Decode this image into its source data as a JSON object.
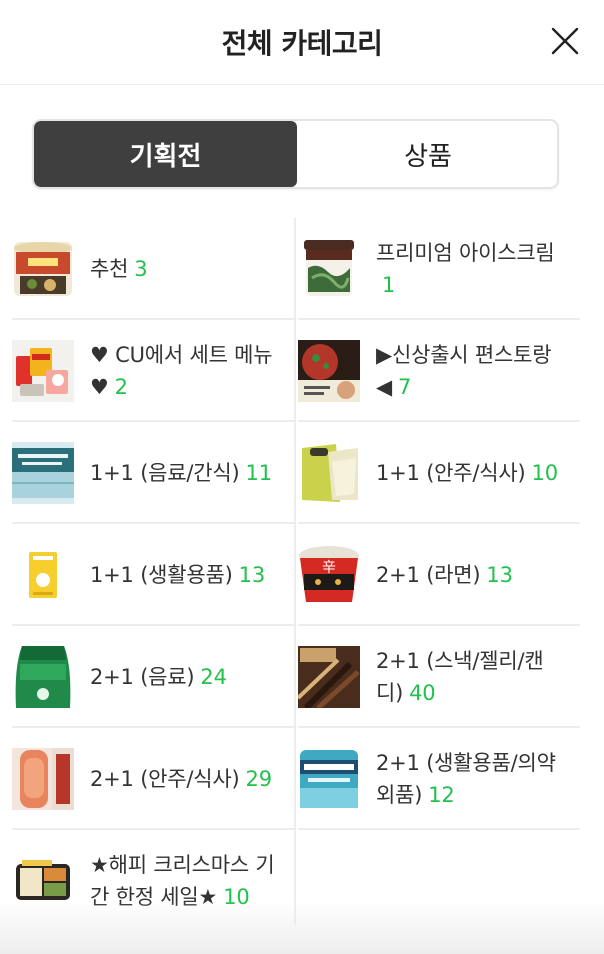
{
  "header": {
    "title": "전체 카테고리",
    "close_icon": "close-icon"
  },
  "tabs": [
    {
      "label": "기획전",
      "active": true
    },
    {
      "label": "상품",
      "active": false
    }
  ],
  "categories": [
    {
      "label": "추천",
      "count": "3",
      "icon": "ramen-cup-icon"
    },
    {
      "label": "프리미엄 아이스크림",
      "count": "1",
      "icon": "ice-cream-tub-icon"
    },
    {
      "label": "♥ CU에서 세트 메뉴 ♥",
      "count": "2",
      "icon": "set-menu-icon"
    },
    {
      "label": "▶신상출시 편스토랑◀",
      "count": "7",
      "icon": "new-product-icon"
    },
    {
      "label": "1+1 (음료/간식)",
      "count": "11",
      "icon": "water-bottle-icon"
    },
    {
      "label": "1+1 (안주/식사)",
      "count": "10",
      "icon": "snack-bag-icon"
    },
    {
      "label": "1+1 (생활용품)",
      "count": "13",
      "icon": "mask-pack-icon"
    },
    {
      "label": "2+1 (라면)",
      "count": "13",
      "icon": "noodle-bowl-icon"
    },
    {
      "label": "2+1 (음료)",
      "count": "24",
      "icon": "soda-bottle-icon"
    },
    {
      "label": "2+1 (스낵/젤리/캔디)",
      "count": "40",
      "icon": "pepero-box-icon"
    },
    {
      "label": "2+1 (안주/식사)",
      "count": "29",
      "icon": "sausage-pack-icon"
    },
    {
      "label": "2+1 (생활용품/의약외품)",
      "count": "12",
      "icon": "mouthwash-icon"
    },
    {
      "label": "★해피 크리스마스 기간 한정 세일★",
      "count": "10",
      "icon": "lunchbox-icon"
    }
  ],
  "colors": {
    "count": "#22c04c",
    "active_tab_bg": "#3f3f3f",
    "divider": "#ededed"
  }
}
